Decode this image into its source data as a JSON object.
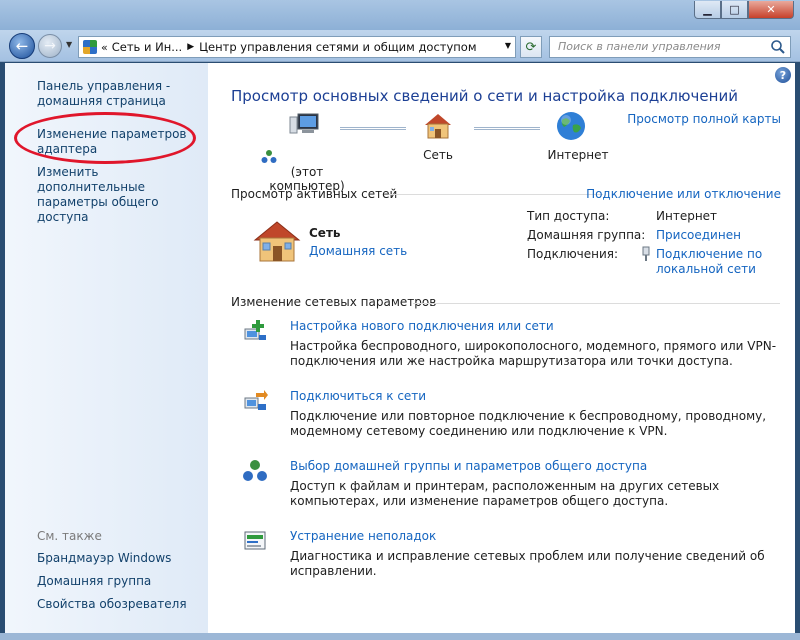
{
  "window": {
    "minimize": "▁",
    "maximize": "□",
    "close": "✕"
  },
  "navbar": {
    "address_overflow": "«",
    "breadcrumb": [
      "Сеть и Ин...",
      "Центр управления сетями и общим доступом"
    ],
    "search_placeholder": "Поиск в панели управления"
  },
  "sidebar": {
    "links": [
      "Панель управления - домашняя страница",
      "Изменение параметров адаптера",
      "Изменить дополнительные параметры общего доступа"
    ],
    "see_also_title": "См. также",
    "see_also": [
      "Брандмауэр Windows",
      "Домашняя группа",
      "Свойства обозревателя"
    ]
  },
  "main": {
    "title": "Просмотр основных сведений о сети и настройка подключений",
    "full_map_link": "Просмотр полной карты",
    "map": {
      "computer_label": "(этот компьютер)",
      "network_label": "Сеть",
      "internet_label": "Интернет"
    },
    "active": {
      "heading": "Просмотр активных сетей",
      "connect_link": "Подключение или отключение",
      "network_name": "Сеть",
      "network_type": "Домашняя сеть",
      "access_label": "Тип доступа:",
      "access_value": "Интернет",
      "homegroup_label": "Домашняя группа:",
      "homegroup_value": "Присоединен",
      "connections_label": "Подключения:",
      "connections_value": "Подключение по локальной сети"
    },
    "change": {
      "heading": "Изменение сетевых параметров",
      "tasks": [
        {
          "link": "Настройка нового подключения или сети",
          "desc": "Настройка беспроводного, широкополосного, модемного, прямого или VPN-подключения или же настройка маршрутизатора или точки доступа."
        },
        {
          "link": "Подключиться к сети",
          "desc": "Подключение или повторное подключение к беспроводному, проводному, модемному сетевому соединению или подключение к VPN."
        },
        {
          "link": "Выбор домашней группы и параметров общего доступа",
          "desc": "Доступ к файлам и принтерам, расположенным на других сетевых компьютерах, или изменение параметров общего доступа."
        },
        {
          "link": "Устранение неполадок",
          "desc": "Диагностика и исправление сетевых проблем или получение сведений об исправлении."
        }
      ]
    }
  },
  "colors": {
    "link": "#1565c0",
    "title": "#1c3f94",
    "annotation": "#e0162b"
  }
}
